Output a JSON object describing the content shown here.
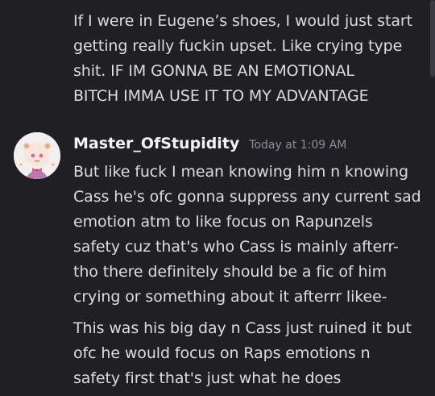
{
  "messages": {
    "previous": {
      "text": "If I were in Eugene’s shoes, I would just start\ngetting really fuckin upset. Like crying type\nshit. IF IM GONNA BE AN EMOTIONAL\nBITCH IMMA USE IT TO MY ADVANTAGE"
    },
    "group": {
      "username": "Master_OfStupidity",
      "timestamp": "Today at 1:09 AM",
      "first": "But like fuck I mean knowing him n knowing\nCass he's ofc gonna suppress any current sad\nemotion atm to like focus on Rapunzels\nsafety cuz that's who Cass is mainly afterr-\ntho there definitely should be a fic of him\ncrying or something about it afterrr likee-",
      "second": "This was his big day n Cass just ruined it but\nofc he would focus on Raps emotions n\nsafety first that's just what he does"
    }
  },
  "colors": {
    "background": "#1f1f24",
    "text": "#dcdde1",
    "username": "#f2f3f5",
    "timestamp": "#8e9099"
  }
}
